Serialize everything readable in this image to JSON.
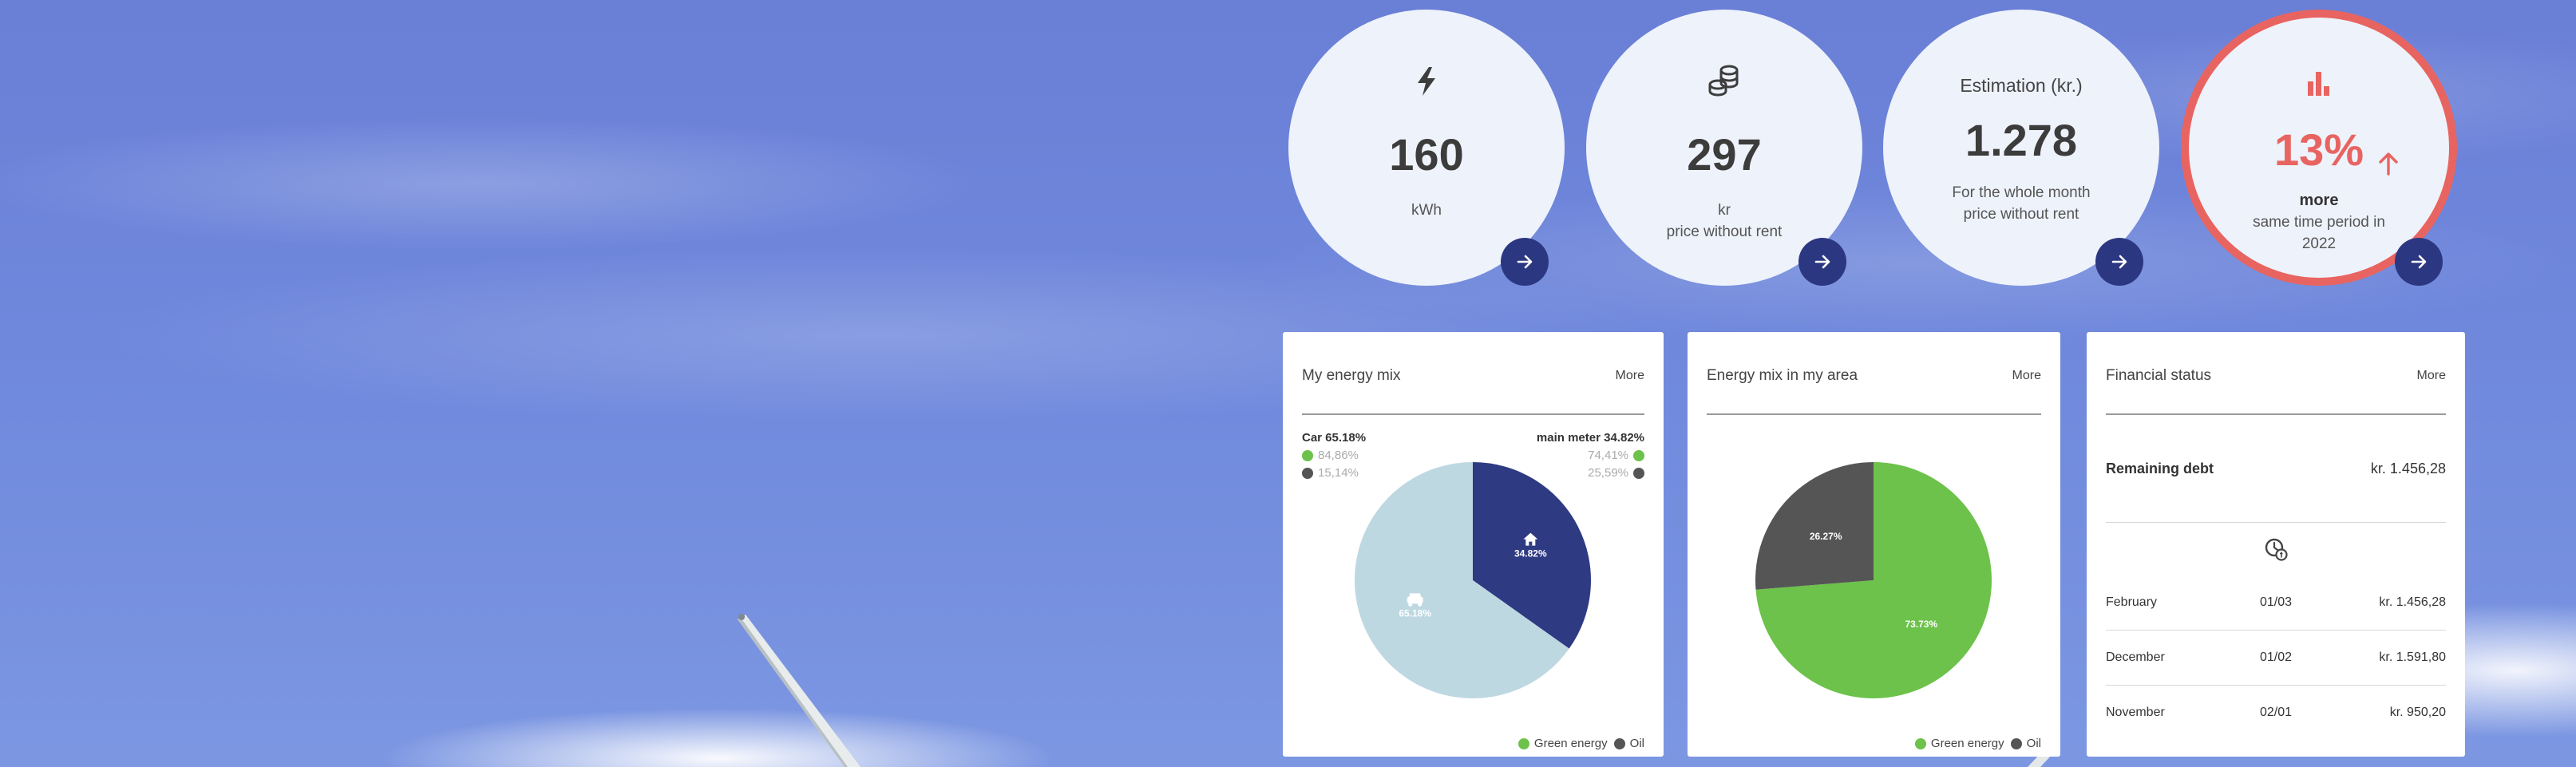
{
  "kpis": [
    {
      "icon": "lightning-icon",
      "value": "160",
      "unit": "kWh"
    },
    {
      "icon": "coins-icon",
      "value": "297",
      "unit": "kr",
      "sub": "price without rent"
    },
    {
      "title": "Estimation (kr.)",
      "value": "1.278",
      "unit": "For the whole month",
      "sub": "price without rent"
    },
    {
      "icon": "bar-chart-icon",
      "value": "13%",
      "bold": "more",
      "sub": "same time period in",
      "sub2": "2022",
      "trend": "up"
    }
  ],
  "energy_mix": {
    "title": "My energy mix",
    "more": "More",
    "car": {
      "label": "Car 65.18%",
      "green": "84,86%",
      "oil": "15,14%"
    },
    "meter": {
      "label": "main meter 34.82%",
      "green": "74,41%",
      "oil": "25,59%"
    },
    "legend": {
      "green": "Green energy",
      "oil": "Oil"
    }
  },
  "area_mix": {
    "title": "Energy mix in my area",
    "more": "More",
    "legend": {
      "green": "Green energy",
      "oil": "Oil"
    }
  },
  "financial": {
    "title": "Financial status",
    "more": "More",
    "debt_label": "Remaining debt",
    "debt_value": "kr. 1.456,28",
    "rows": [
      {
        "month": "February",
        "date": "01/03",
        "amount": "kr. 1.456,28"
      },
      {
        "month": "December",
        "date": "01/02",
        "amount": "kr. 1.591,80"
      },
      {
        "month": "November",
        "date": "02/01",
        "amount": "kr. 950,20"
      }
    ]
  },
  "chart_data": [
    {
      "type": "pie",
      "title": "My energy mix",
      "categories": [
        "main meter",
        "Car"
      ],
      "values": [
        34.82,
        65.18
      ],
      "data_labels": [
        "34.82%",
        "65.18%"
      ],
      "colors": [
        "#2e3a82",
        "#bed8e2"
      ]
    },
    {
      "type": "pie",
      "title": "Energy mix in my area",
      "categories": [
        "Green energy",
        "Oil"
      ],
      "values": [
        73.73,
        26.27
      ],
      "data_labels": [
        "73.73%",
        "26.27%"
      ],
      "colors": [
        "#6cc24a",
        "#555555"
      ]
    }
  ],
  "colors": {
    "navy": "#2c3781",
    "alert": "#e86461",
    "green": "#6cc24a",
    "oil": "#555555",
    "car": "#bed8e2"
  }
}
